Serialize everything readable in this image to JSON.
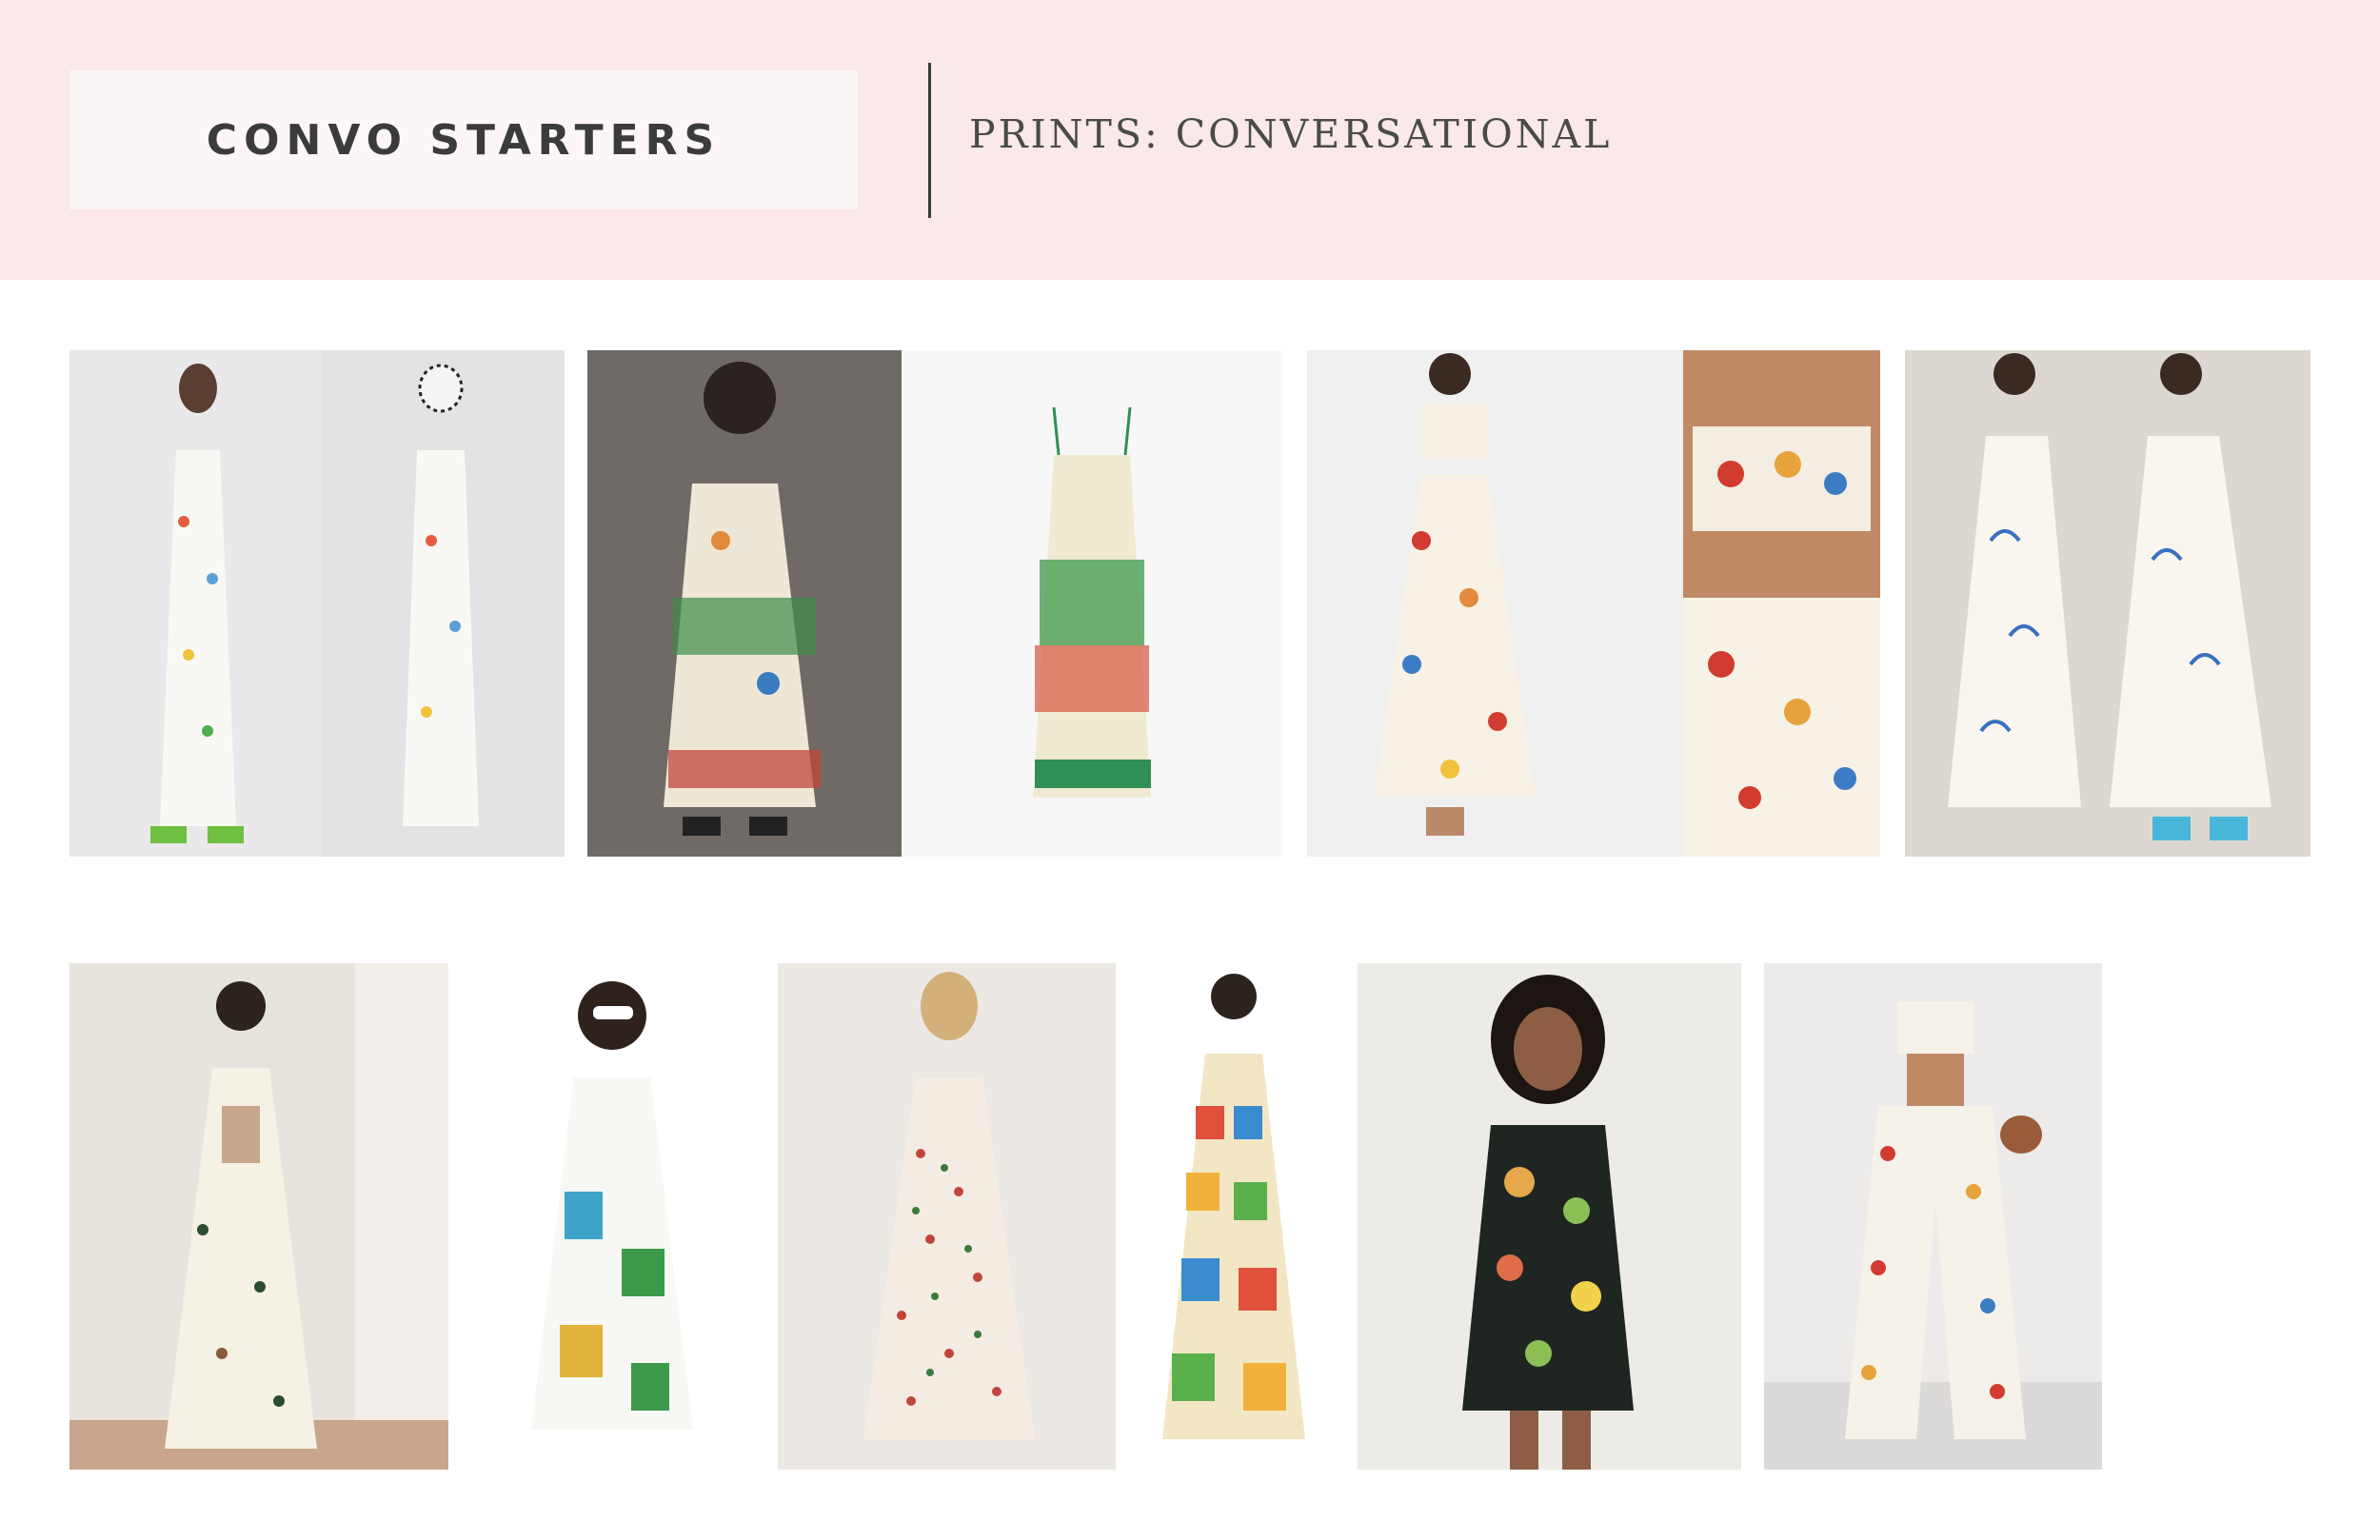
{
  "header": {
    "title": "CONVO STARTERS",
    "subtitle": "PRINTS: CONVERSATIONAL"
  },
  "colors": {
    "header_bg": "#fbe8e8",
    "title_box_bg": "#fcf6f6",
    "text_dark": "#3b3b3b"
  },
  "gallery": {
    "row1": [
      {
        "name": "photo-strapless-ciao-dress-front-back"
      },
      {
        "name": "photo-palm-print-sundress-model"
      },
      {
        "name": "photo-palm-print-sundress-product"
      },
      {
        "name": "photo-seashell-crop-top-skirt-set"
      },
      {
        "name": "photo-seashell-set-detail"
      },
      {
        "name": "photo-cocktail-sketch-dress-front-back"
      }
    ],
    "row2": [
      {
        "name": "photo-tie-back-icon-print-dress"
      },
      {
        "name": "photo-postcard-print-midi-dress"
      },
      {
        "name": "photo-floral-tiered-midi-dress"
      },
      {
        "name": "photo-stamp-print-maxi-dress"
      },
      {
        "name": "photo-black-fruit-print-mini-dress"
      },
      {
        "name": "photo-food-print-crop-top-pants-set"
      }
    ]
  }
}
